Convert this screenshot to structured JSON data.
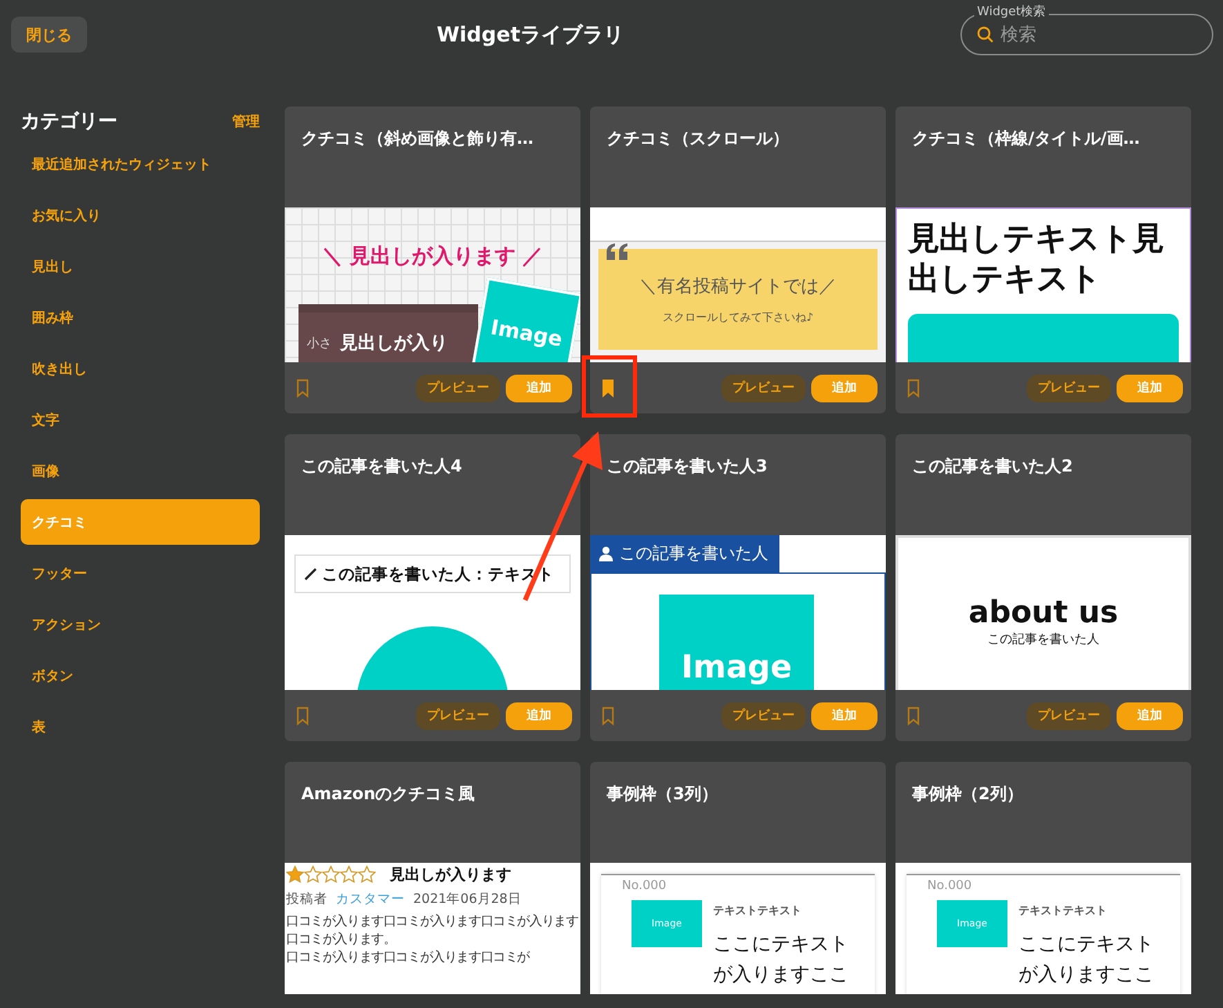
{
  "header": {
    "close_button": "閉じる",
    "title": "Widgetライブラリ",
    "search": {
      "legend": "Widget検索",
      "placeholder": "検索"
    }
  },
  "sidebar": {
    "title": "カテゴリー",
    "manage": "管理",
    "items": [
      {
        "label": "最近追加されたウィジェット",
        "selected": false
      },
      {
        "label": "お気に入り",
        "selected": false
      },
      {
        "label": "見出し",
        "selected": false
      },
      {
        "label": "囲み枠",
        "selected": false
      },
      {
        "label": "吹き出し",
        "selected": false
      },
      {
        "label": "文字",
        "selected": false
      },
      {
        "label": "画像",
        "selected": false
      },
      {
        "label": "クチコミ",
        "selected": true
      },
      {
        "label": "フッター",
        "selected": false
      },
      {
        "label": "アクション",
        "selected": false
      },
      {
        "label": "ボタン",
        "selected": false
      },
      {
        "label": "表",
        "selected": false
      }
    ]
  },
  "cards": [
    {
      "title": "クチコミ（斜め画像と飾り有…",
      "bookmarked": false,
      "preview_button": "プレビュー",
      "add_button": "追加",
      "preview": {
        "kind": "tilted",
        "heading": "＼ 見出しが入ります ／",
        "label": "小さ",
        "subheading": "見出しが入り",
        "image_label": "Image"
      }
    },
    {
      "title": "クチコミ（スクロール）",
      "bookmarked": true,
      "preview_button": "プレビュー",
      "add_button": "追加",
      "preview": {
        "kind": "scroll",
        "heading": "＼有名投稿サイトでは／",
        "text": "スクロールしてみて下さいね♪"
      }
    },
    {
      "title": "クチコミ（枠線/タイトル/画…",
      "bookmarked": false,
      "preview_button": "プレビュー",
      "add_button": "追加",
      "preview": {
        "kind": "bordered",
        "heading": "見出しテキスト見出しテキスト"
      }
    },
    {
      "title": "この記事を書いた人4",
      "bookmarked": false,
      "preview_button": "プレビュー",
      "add_button": "追加",
      "preview": {
        "kind": "pen_label",
        "label": "この記事を書いた人：テキスト"
      }
    },
    {
      "title": "この記事を書いた人3",
      "bookmarked": false,
      "preview_button": "プレビュー",
      "add_button": "追加",
      "preview": {
        "kind": "tab_label",
        "label": "この記事を書いた人",
        "image_label": "Image"
      }
    },
    {
      "title": "この記事を書いた人2",
      "bookmarked": false,
      "preview_button": "プレビュー",
      "add_button": "追加",
      "preview": {
        "kind": "about",
        "heading": "about us",
        "text": "この記事を書いた人"
      }
    },
    {
      "title": "Amazonのクチコミ風",
      "preview": {
        "kind": "review",
        "stars": 1,
        "heading": "見出しが入ります",
        "author_label": "投稿者",
        "author": "カスタマー",
        "date": "2021年06月28日",
        "paragraphs": [
          "口コミが入ります口コミが入ります口コミが入ります口コミが入ります。",
          "口コミが入ります口コミが入ります口コミが"
        ]
      }
    },
    {
      "title": "事例枠（3列）",
      "preview": {
        "kind": "case",
        "number": "No.000",
        "image_label": "Image",
        "label": "テキストテキスト",
        "lines": [
          "ここにテキスト",
          "が入りますここ"
        ]
      }
    },
    {
      "title": "事例枠（2列）",
      "preview": {
        "kind": "case",
        "number": "No.000",
        "image_label": "Image",
        "label": "テキストテキスト",
        "lines": [
          "ここにテキスト",
          "が入りますここ"
        ]
      }
    }
  ]
}
